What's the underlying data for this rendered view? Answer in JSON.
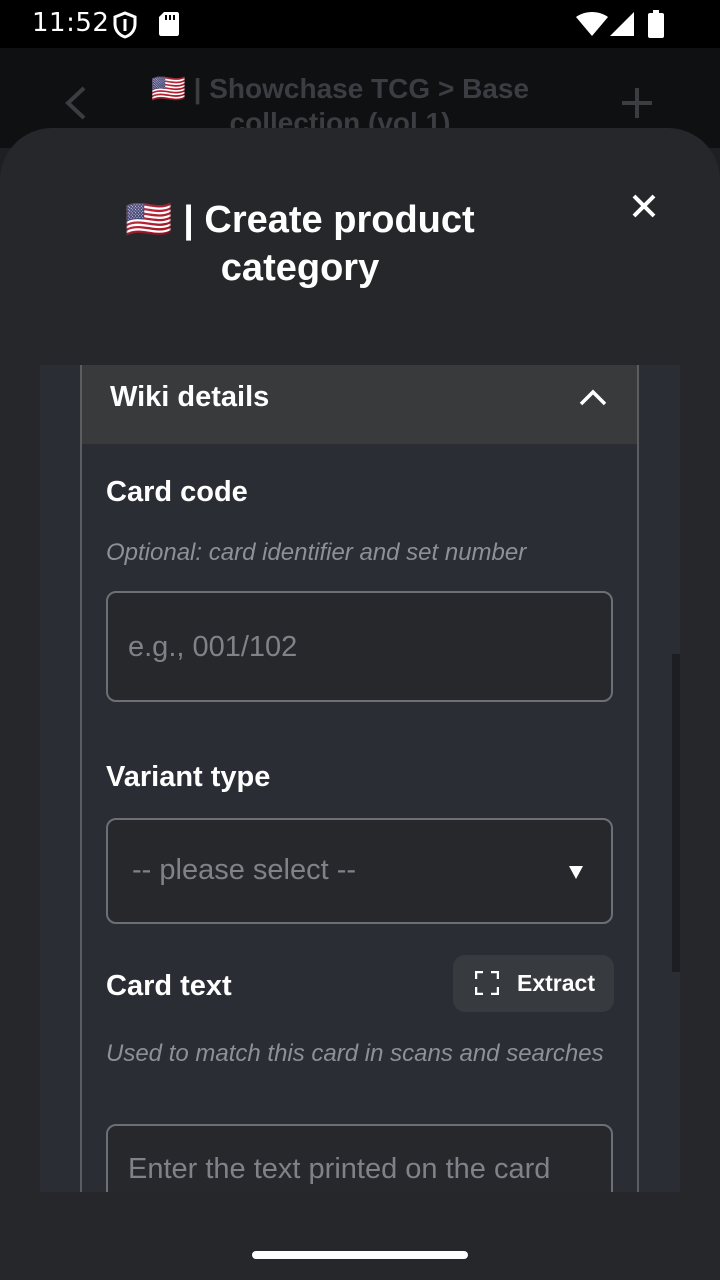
{
  "status_bar": {
    "time": "11:52",
    "icons": [
      "shield-icon",
      "sim-card-icon",
      "wifi-icon",
      "signal-icon",
      "battery-icon"
    ]
  },
  "background_page": {
    "title": "🇺🇸 | Showchase TCG > Base collection (vol 1)",
    "icons": [
      "back-arrow-icon",
      "add-icon"
    ]
  },
  "sheet": {
    "title": "🇺🇸 | Create product category",
    "close_icon": "close-icon"
  },
  "section": {
    "title": "Wiki details",
    "expanded": true,
    "chevron_icon": "chevron-up-icon"
  },
  "fields": {
    "card_code": {
      "label": "Card code",
      "hint": "Optional: card identifier and set number",
      "placeholder": "e.g., 001/102"
    },
    "variant_type": {
      "label": "Variant type",
      "selected": "-- please select --",
      "dropdown_icon": "dropdown-triangle-icon"
    },
    "card_text": {
      "label": "Card text",
      "hint": "Used to match this card in scans and searches",
      "placeholder": "Enter the text printed on the card",
      "extract_label": "Extract",
      "extract_icon": "scan-frame-icon"
    }
  },
  "colors": {
    "sheet_background": "#25272b",
    "section_header": "#393a3c",
    "input_border": "#6c6f75",
    "hint_text": "#8d9096"
  }
}
